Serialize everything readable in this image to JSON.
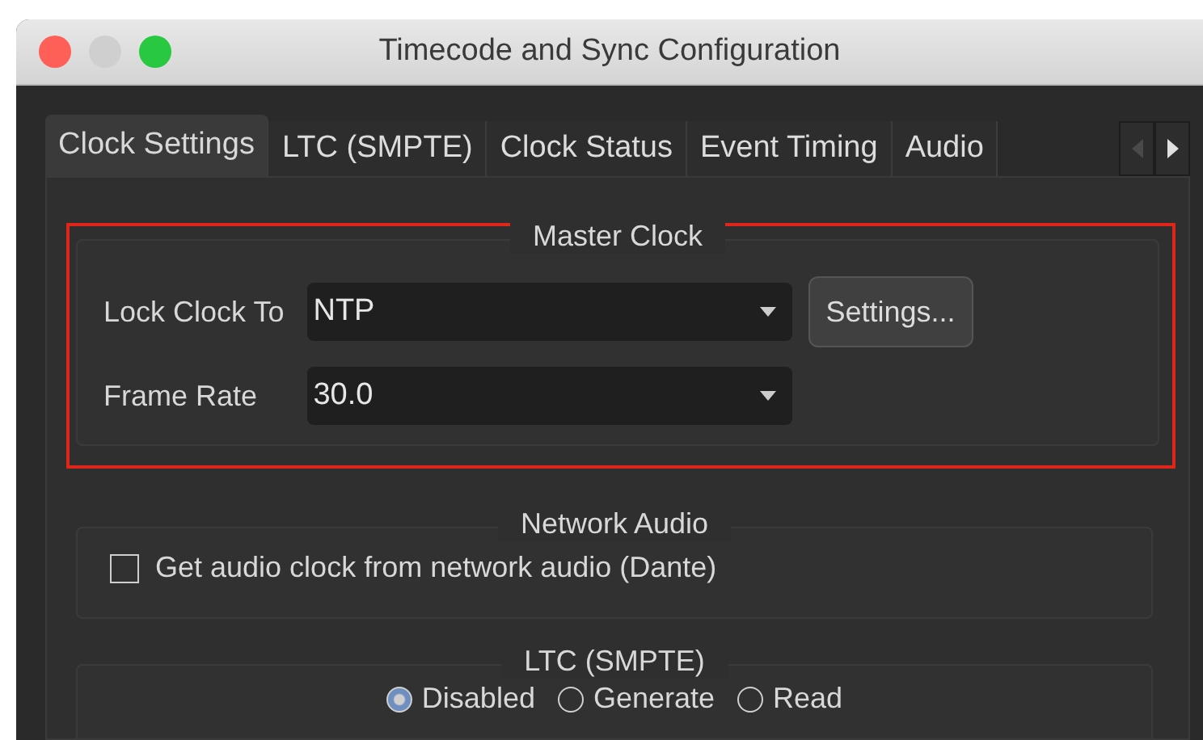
{
  "window": {
    "title": "Timecode and Sync Configuration"
  },
  "tabs": [
    {
      "label": "Clock Settings",
      "selected": true
    },
    {
      "label": "LTC (SMPTE)",
      "selected": false
    },
    {
      "label": "Clock Status",
      "selected": false
    },
    {
      "label": "Event Timing",
      "selected": false
    },
    {
      "label": "Audio",
      "selected": false
    }
  ],
  "master_clock": {
    "title": "Master Clock",
    "highlighted": true,
    "lock_clock_to": {
      "label": "Lock Clock To",
      "value": "NTP"
    },
    "settings_button": "Settings...",
    "frame_rate": {
      "label": "Frame Rate",
      "value": "30.0"
    }
  },
  "network_audio": {
    "title": "Network Audio",
    "checkbox": {
      "label": "Get audio clock from network audio (Dante)",
      "checked": false
    }
  },
  "ltc": {
    "title": "LTC (SMPTE)",
    "options": [
      {
        "label": "Disabled",
        "selected": true
      },
      {
        "label": "Generate",
        "selected": false
      },
      {
        "label": "Read",
        "selected": false
      }
    ]
  }
}
